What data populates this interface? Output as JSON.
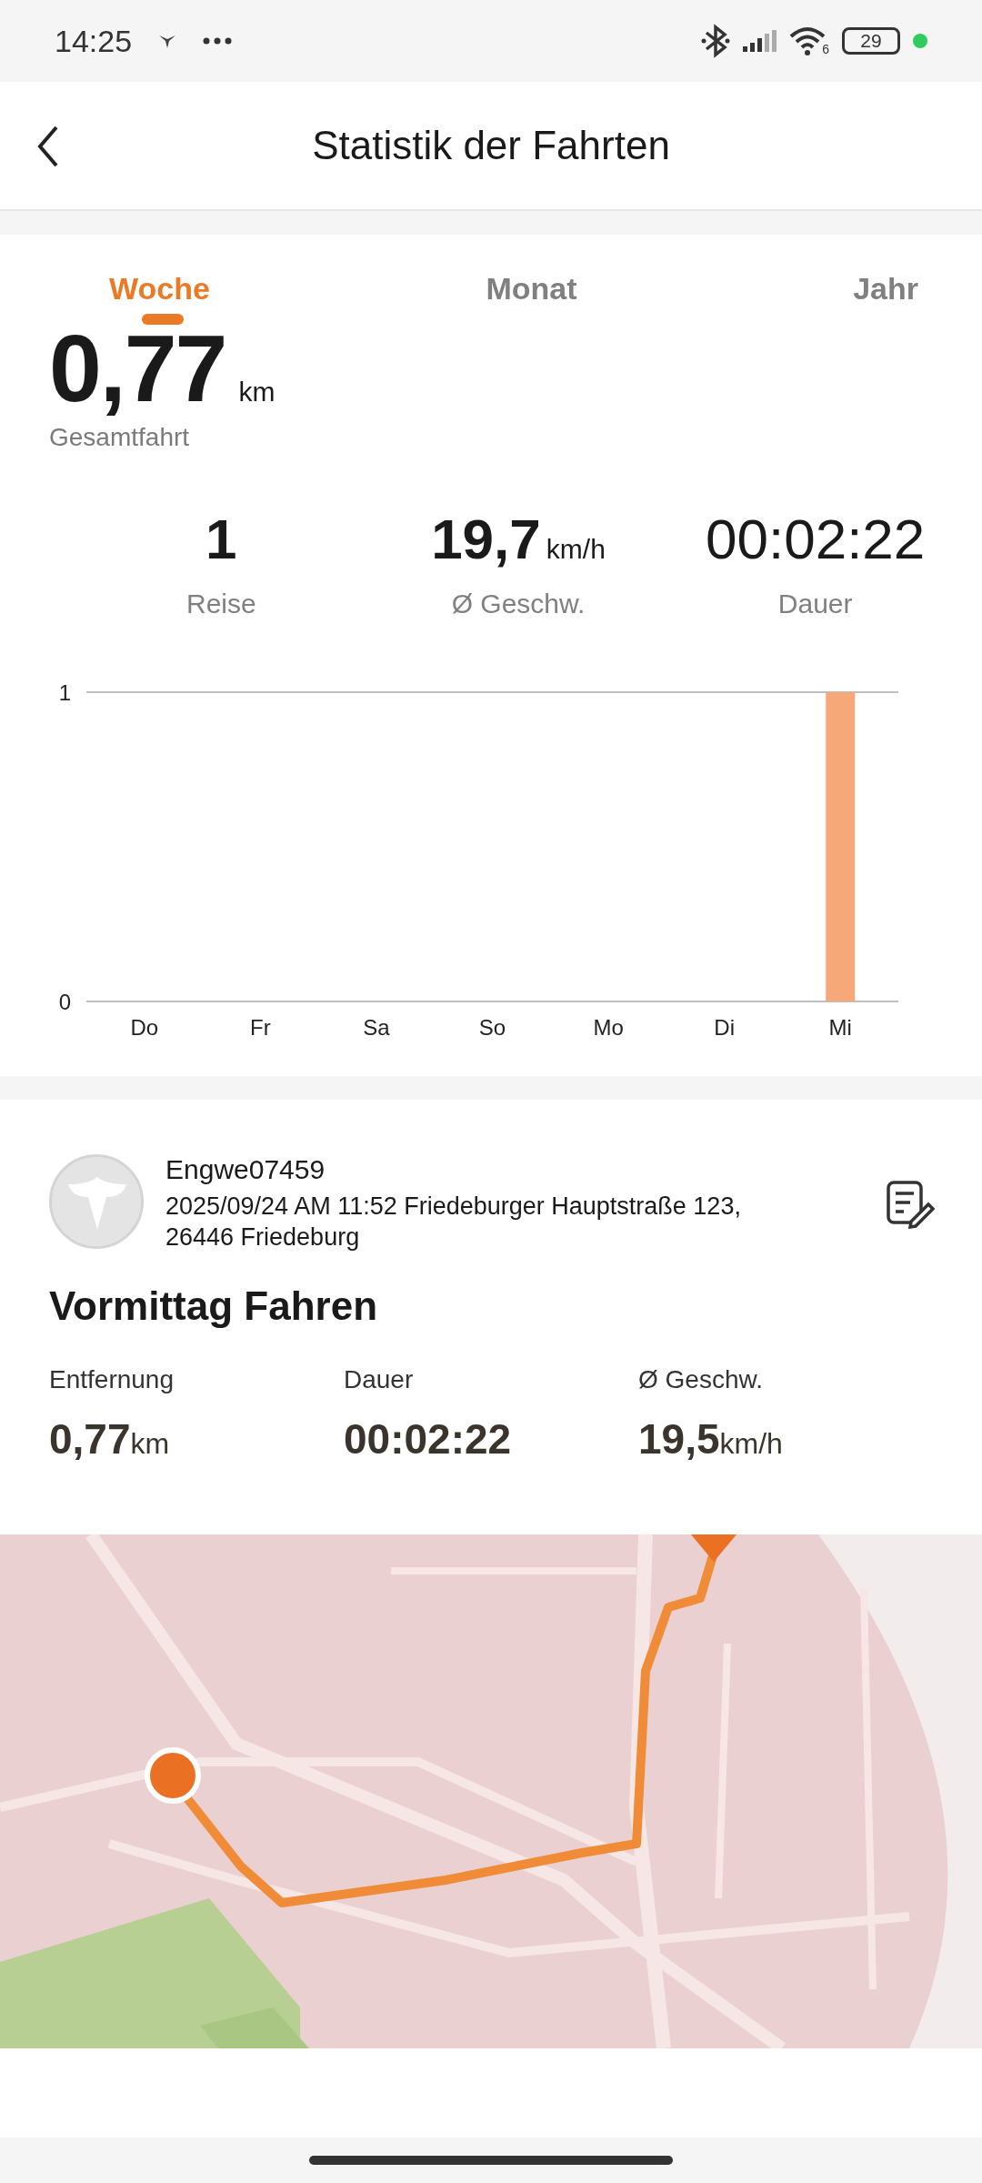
{
  "status_bar": {
    "time": "14:25",
    "wifi_generation": "6",
    "battery": "29"
  },
  "header": {
    "title": "Statistik der Fahrten"
  },
  "tabs": [
    {
      "label": "Woche",
      "selected": true
    },
    {
      "label": "Monat",
      "selected": false
    },
    {
      "label": "Jahr",
      "selected": false
    }
  ],
  "total": {
    "value": "0,77",
    "unit": "km",
    "label": "Gesamtfahrt"
  },
  "summary": [
    {
      "value": "1",
      "label": "Reise"
    },
    {
      "value": "19,7",
      "unit": "km/h",
      "label": "Ø Geschw."
    },
    {
      "value": "00:02:22",
      "label": "Dauer"
    }
  ],
  "chart_data": {
    "type": "bar",
    "categories": [
      "Do",
      "Fr",
      "Sa",
      "So",
      "Mo",
      "Di",
      "Mi"
    ],
    "series": [
      {
        "color": "#f7a878",
        "values": [
          0,
          0,
          0,
          0,
          0,
          0,
          1
        ]
      }
    ],
    "ylim": [
      0,
      1
    ],
    "yticks": [
      0,
      1
    ]
  },
  "trip": {
    "device": "Engwe07459",
    "details": "2025/09/24 AM 11:52 Friedeburger Hauptstraße 123, 26446 Friedeburg",
    "title": "Vormittag Fahren",
    "stats": [
      {
        "label": "Entfernung",
        "value": "0,77",
        "unit": "km"
      },
      {
        "label": "Dauer",
        "value": "00:02:22"
      },
      {
        "label": "Ø Geschw.",
        "value": "19,5",
        "unit": "km/h"
      }
    ]
  }
}
